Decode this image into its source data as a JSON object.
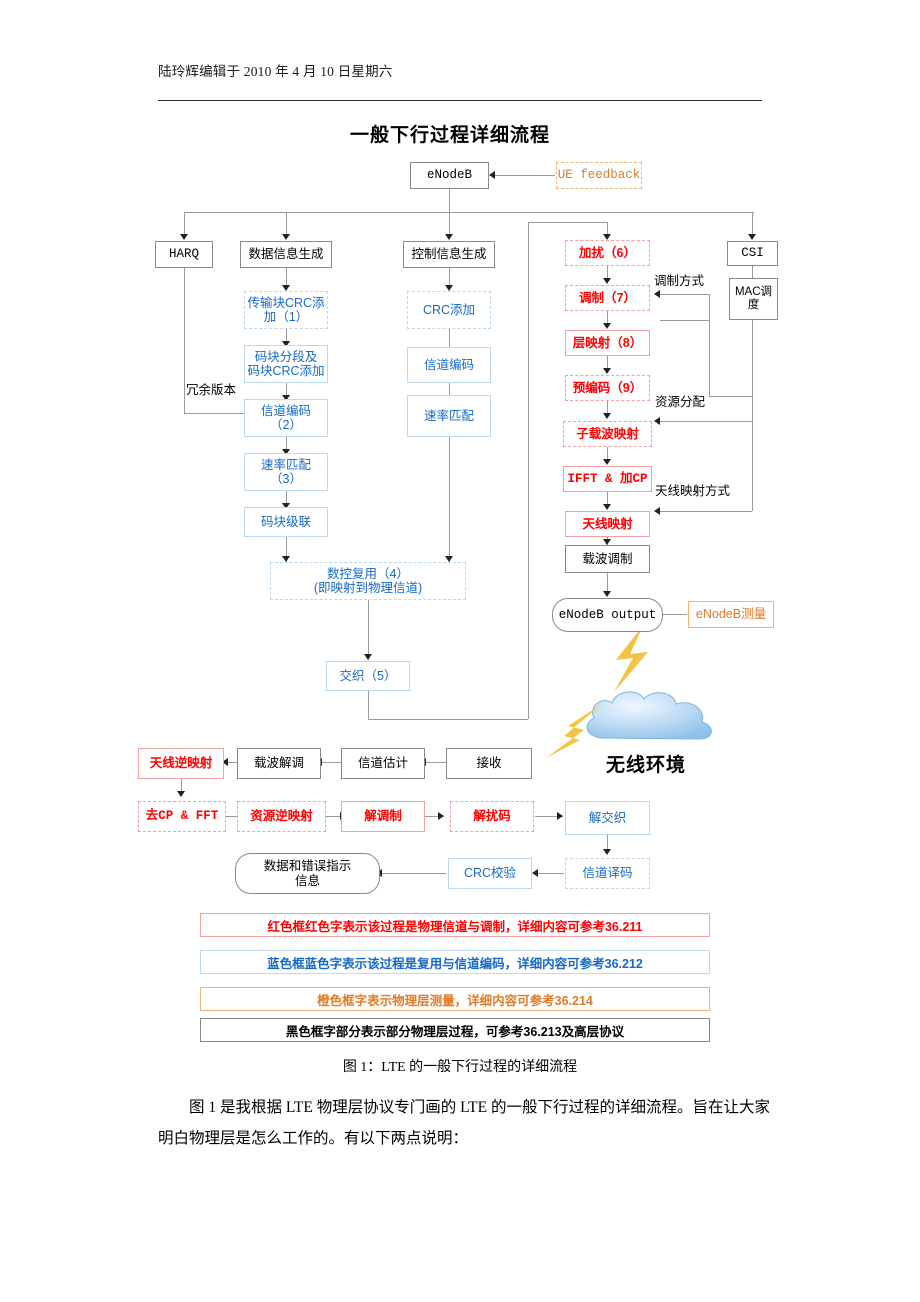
{
  "header": {
    "edited_by": "陆玲辉编辑于 2010 年 4 月 10 日星期六"
  },
  "figure": {
    "title": "一般下行过程详细流程",
    "caption": "图 1：LTE 的一般下行过程的详细流程"
  },
  "nodes": {
    "enodeb": "eNodeB",
    "ue_feedback": "UE feedback",
    "harq": "HARQ",
    "data_gen": "数据信息生成",
    "ctrl_gen": "控制信息生成",
    "csi": "CSI",
    "mac_sched_l1": "MAC调",
    "mac_sched_l2": "度",
    "tb_crc_l1": "传输块CRC添",
    "tb_crc_l2": "加（1）",
    "cb_seg_l1": "码块分段及",
    "cb_seg_l2": "码块CRC添加",
    "ch_code_l1": "信道编码",
    "ch_code_l2": "（2）",
    "rate_match_l1": "速率匹配",
    "rate_match_l2": "（3）",
    "cb_concat": "码块级联",
    "crc_add": "CRC添加",
    "ch_code_ctrl": "信道编码",
    "rate_match_ctrl": "速率匹配",
    "mux_l1": "数控复用（4）",
    "mux_l2": "(即映射到物理信道)",
    "interleave": "交织（5）",
    "scramble": "加扰（6）",
    "modulate": "调制（7）",
    "layer_map": "层映射（8）",
    "precode": "预编码（9）",
    "subcarrier_map": "子载波映射",
    "ifft_cp": "IFFT & 加CP",
    "antenna_map": "天线映射",
    "carrier_mod": "载波调制",
    "enodeb_output": "eNodeB output",
    "enodeb_meas": "eNodeB测量",
    "wireless_env": "无线环境",
    "ant_demap": "天线逆映射",
    "carrier_demod": "载波解调",
    "ch_est": "信道估计",
    "receive": "接收",
    "cp_fft": "去CP & FFT",
    "res_demap": "资源逆映射",
    "demod": "解调制",
    "descramble": "解扰码",
    "deinterleave": "解交织",
    "ch_decode": "信道译码",
    "crc_check": "CRC校验",
    "data_err_l1": "数据和错误指示",
    "data_err_l2": "信息"
  },
  "edge_labels": {
    "redundancy": "冗余版本",
    "mod_scheme": "调制方式",
    "res_alloc": "资源分配",
    "ant_map_scheme": "天线映射方式"
  },
  "legend": [
    {
      "id": "red",
      "text": "红色框红色字表示该过程是物理信道与调制，详细内容可参考36.211"
    },
    {
      "id": "blue",
      "text": "蓝色框蓝色字表示该过程是复用与信道编码，详细内容可参考36.212"
    },
    {
      "id": "orange",
      "text": "橙色框字表示物理层测量，详细内容可参考36.214"
    },
    {
      "id": "black",
      "text": "黑色框字部分表示部分物理层过程，可参考36.213及高层协议"
    }
  ],
  "body": {
    "paragraph": "图 1 是我根据 LTE 物理层协议专门画的 LTE 的一般下行过程的详细流程。旨在让大家明白物理层是怎么工作的。有以下两点说明："
  },
  "colors": {
    "red": "#ff0000",
    "blue": "#1569c7",
    "orange": "#e07b27",
    "black": "#000000",
    "connector": "#9a9a9a",
    "cloud": "#a8cdee",
    "bolt": "#f5c242"
  }
}
